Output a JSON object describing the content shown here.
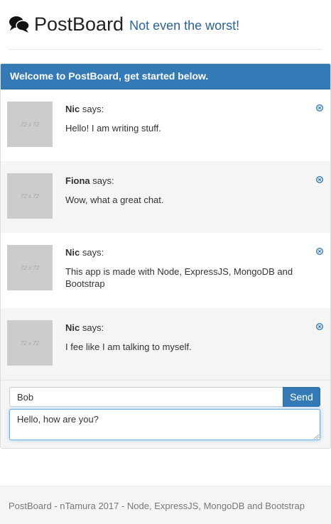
{
  "header": {
    "brand": "PostBoard",
    "tagline": "Not even the worst!",
    "logo_icon": "comments-icon"
  },
  "panel": {
    "heading": "Welcome to PostBoard, get started below.",
    "messages": [
      {
        "author": "Nic",
        "says": " says:",
        "text": "Hello! I am writing stuff.",
        "thumb_label": "72 x 72"
      },
      {
        "author": "Fiona",
        "says": " says:",
        "text": "Wow, what a great chat.",
        "thumb_label": "72 x 72"
      },
      {
        "author": "Nic",
        "says": " says:",
        "text": "This app is made with Node, ExpressJS, MongoDB and Bootstrap",
        "thumb_label": "72 x 72"
      },
      {
        "author": "Nic",
        "says": " says:",
        "text": "I fee like I am talking to myself.",
        "thumb_label": "72 x 72"
      }
    ]
  },
  "form": {
    "name_value": "Bob",
    "send_label": "Send",
    "message_value": "Hello, how are you?"
  },
  "footer": {
    "text": "PostBoard - nTamura 2017 - Node, ExpressJS, MongoDB and Bootstrap"
  },
  "colors": {
    "primary": "#337ab7",
    "tagline": "#2a6496",
    "alt_row": "#f5f5f5"
  }
}
